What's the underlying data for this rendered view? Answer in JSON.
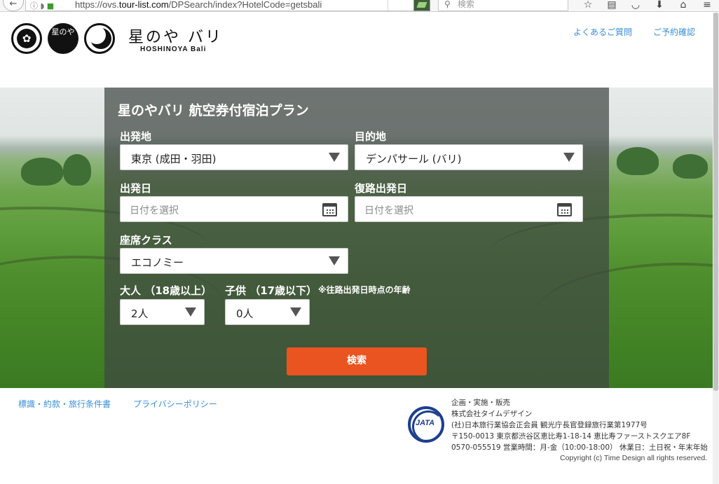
{
  "browser": {
    "url_prefix": "https://ovs.",
    "url_domain": "tour-list.com",
    "url_path": "/DPSearch/index?HotelCode=getsbali",
    "search_placeholder": "検索",
    "icons": [
      "back-icon",
      "info-icon",
      "shield-icon",
      "lock-icon",
      "reload-icon",
      "star-icon",
      "reader-icon",
      "pocket-icon",
      "download-icon",
      "home-icon",
      "menu-icon"
    ]
  },
  "header": {
    "logo_seal_text": "星のや",
    "brand_jp": "星のや バリ",
    "brand_en": "HOSHINOYA Bali",
    "links": {
      "faq": "よくあるご質問",
      "reservation_check": "ご予約確認"
    }
  },
  "form": {
    "title": "星のやバリ 航空券付宿泊プラン",
    "departure": {
      "label": "出発地",
      "value": "東京 (成田・羽田)"
    },
    "destination": {
      "label": "目的地",
      "value": "デンパサール (バリ)"
    },
    "depart_date": {
      "label": "出発日",
      "placeholder": "日付を選択"
    },
    "return_date": {
      "label": "復路出発日",
      "placeholder": "日付を選択"
    },
    "seat_class": {
      "label": "座席クラス",
      "value": "エコノミー"
    },
    "adults": {
      "label": "大人 （18歳以上）",
      "value": "2人"
    },
    "children": {
      "label": "子供 （17歳以下）",
      "value": "0人"
    },
    "age_note": "※往路出発日時点の年齢",
    "search_button": "検索"
  },
  "footer": {
    "links": {
      "terms": "標識・約款・旅行条件書",
      "privacy": "プライバシーポリシー"
    },
    "jata_logo": "JATA",
    "company_lines": [
      "企画・実施・販売",
      "株式会社タイムデザイン",
      "(社)日本旅行業協会正会員 観光庁長官登録旅行業第1977号",
      "〒150-0013 東京都渋谷区恵比寿1-18-14 恵比寿ファーストスクエア8F",
      "0570-055519 営業時間：月-金（10:00-18:00） 休業日：土日祝・年末年始"
    ],
    "copyright": "Copyright (c) Time Design all rights reserved."
  },
  "colors": {
    "accent_button": "#e95420",
    "link": "#3a8fd9",
    "panel_overlay": "rgba(64,70,66,0.72)"
  }
}
